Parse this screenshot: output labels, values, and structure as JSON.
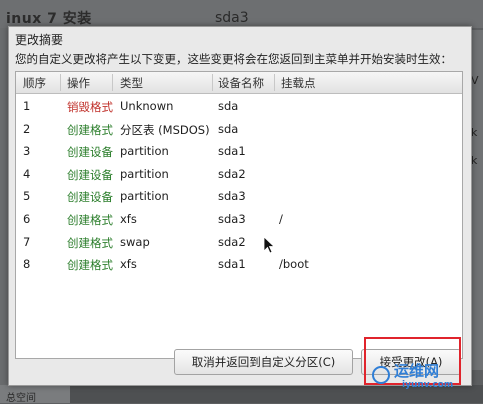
{
  "background": {
    "title": "inux 7 安装",
    "device_label": "sda3",
    "right_letters": [
      "V",
      "k",
      "k"
    ],
    "bottom_label": "总空间"
  },
  "dialog": {
    "title": "更改摘要",
    "message": "您的自定义更改将产生以下变更，这些变更将会在您返回到主菜单并开始安装时生效：",
    "columns": [
      "顺序",
      "操作",
      "类型",
      "设备名称",
      "挂载点"
    ],
    "rows": [
      {
        "order": "1",
        "action": "销毁格式",
        "action_kind": "destroy",
        "type": "Unknown",
        "device": "sda",
        "mount": ""
      },
      {
        "order": "2",
        "action": "创建格式",
        "action_kind": "create",
        "type": "分区表 (MSDOS)",
        "device": "sda",
        "mount": ""
      },
      {
        "order": "3",
        "action": "创建设备",
        "action_kind": "create",
        "type": "partition",
        "device": "sda1",
        "mount": ""
      },
      {
        "order": "4",
        "action": "创建设备",
        "action_kind": "create",
        "type": "partition",
        "device": "sda2",
        "mount": ""
      },
      {
        "order": "5",
        "action": "创建设备",
        "action_kind": "create",
        "type": "partition",
        "device": "sda3",
        "mount": ""
      },
      {
        "order": "6",
        "action": "创建格式",
        "action_kind": "create",
        "type": "xfs",
        "device": "sda3",
        "mount": "/"
      },
      {
        "order": "7",
        "action": "创建格式",
        "action_kind": "create",
        "type": "swap",
        "device": "sda2",
        "mount": ""
      },
      {
        "order": "8",
        "action": "创建格式",
        "action_kind": "create",
        "type": "xfs",
        "device": "sda1",
        "mount": "/boot"
      }
    ],
    "cancel_label": "取消并返回到自定义分区(C)",
    "accept_label": "接受更改(A)"
  },
  "watermark": {
    "main": "运维网",
    "sub": "iyunv.com"
  },
  "colors": {
    "destroy": "#c0302a",
    "create": "#2a7d2a",
    "highlight": "#e0242c"
  }
}
